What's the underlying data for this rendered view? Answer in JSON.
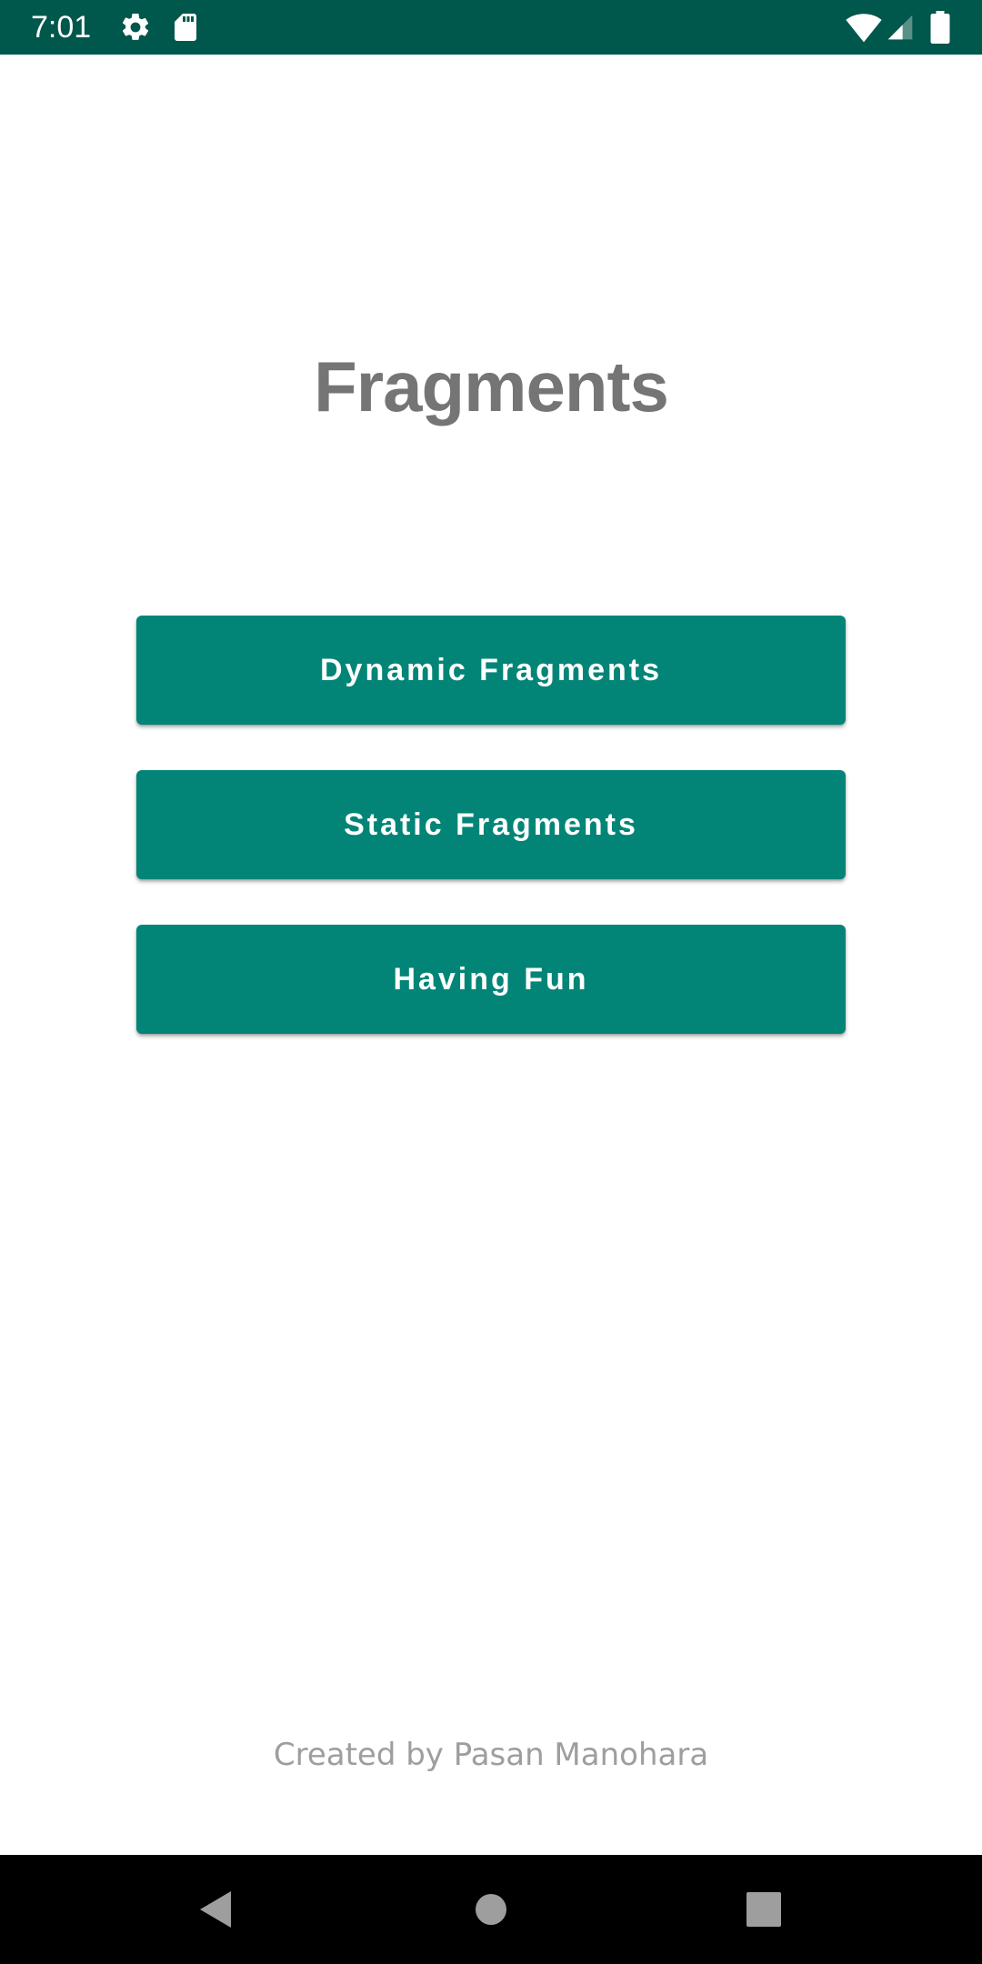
{
  "status_bar": {
    "time": "7:01",
    "background_color": "#00574b",
    "icons": [
      "gear-icon",
      "sd-card-icon",
      "wifi-icon",
      "cell-signal-icon",
      "battery-icon"
    ]
  },
  "main": {
    "title": "Fragments",
    "buttons": [
      {
        "label": "Dynamic Fragments"
      },
      {
        "label": "Static Fragments"
      },
      {
        "label": "Having Fun"
      }
    ],
    "button_color": "#028577",
    "credit": "Created by Pasan Manohara"
  },
  "nav_bar": {
    "buttons": [
      "back-icon",
      "home-icon",
      "recents-icon"
    ]
  }
}
